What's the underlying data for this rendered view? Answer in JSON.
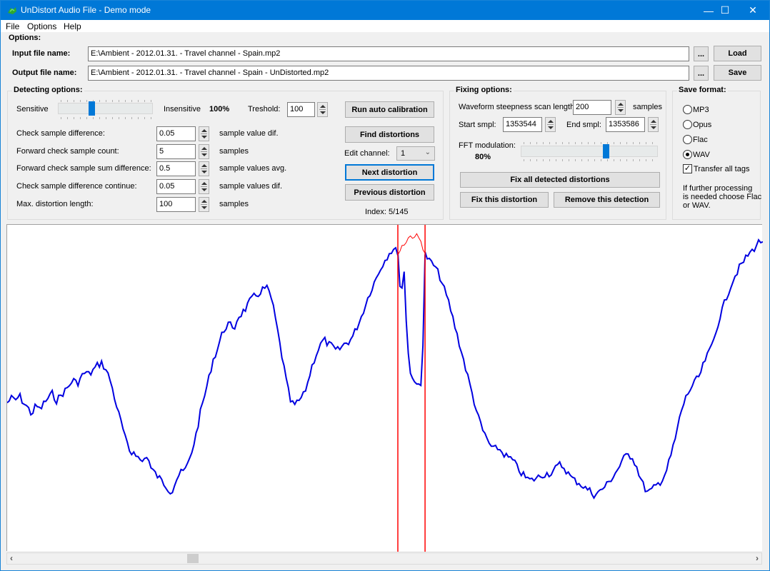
{
  "window": {
    "title": "UnDistort Audio File - Demo mode",
    "controls": {
      "minimize": "—",
      "maximize": "☐",
      "close": "✕"
    }
  },
  "menu": [
    "File",
    "Options",
    "Help"
  ],
  "options": {
    "section_label": "Options:",
    "input_label": "Input file name:",
    "input_value": "E:\\Ambient - 2012.01.31. - Travel channel - Spain.mp2",
    "output_label": "Output file name:",
    "output_value": "E:\\Ambient - 2012.01.31. - Travel channel - Spain - UnDistorted.mp2",
    "browse_label": "...",
    "load_label": "Load",
    "save_label": "Save"
  },
  "detecting": {
    "title": "Detecting options:",
    "sensitive_label": "Sensitive",
    "insensitive_label": "Insensitive",
    "sensitivity_value": "100%",
    "sensitivity_slider_fraction": 0.35,
    "threshold_label": "Treshold:",
    "threshold_value": "100",
    "params": [
      {
        "label": "Check sample difference:",
        "value": "0.05",
        "unit": "sample value dif."
      },
      {
        "label": "Forward check sample count:",
        "value": "5",
        "unit": "samples"
      },
      {
        "label": "Forward check sample sum difference:",
        "value": "0.5",
        "unit": "sample values avg."
      },
      {
        "label": "Check sample difference continue:",
        "value": "0.05",
        "unit": "sample values dif."
      },
      {
        "label": "Max. distortion length:",
        "value": "100",
        "unit": "samples"
      }
    ]
  },
  "actions": {
    "run_calibration": "Run auto calibration",
    "find_distortions": "Find distortions",
    "edit_channel_label": "Edit channel:",
    "edit_channel_value": "1",
    "next_distortion": "Next distortion",
    "previous_distortion": "Previous distortion",
    "index_text": "Index: 5/145"
  },
  "fixing": {
    "title": "Fixing options:",
    "scan_length_label": "Waveform steepness scan length:",
    "scan_length_value": "200",
    "scan_length_unit": "samples",
    "start_label": "Start smpl:",
    "start_value": "1353544",
    "end_label": "End smpl:",
    "end_value": "1353586",
    "fft_label": "FFT modulation:",
    "fft_value": "80%",
    "fft_slider_fraction": 0.62,
    "fix_all": "Fix all detected distortions",
    "fix_this": "Fix this distortion",
    "remove_detection": "Remove this detection"
  },
  "save_format": {
    "title": "Save format:",
    "options": [
      "MP3",
      "Opus",
      "Flac",
      "WAV"
    ],
    "selected": "WAV",
    "transfer_tags_label": "Transfer all tags",
    "transfer_tags_checked": true,
    "note": [
      "If further processing",
      "is needed choose Flac",
      "or WAV."
    ]
  },
  "waveform": {
    "colors": {
      "signal": "#0000e0",
      "fixed": "#ff0000",
      "marker": "#ff0000"
    },
    "marker_positions": [
      0.517,
      0.553
    ],
    "signal": [
      0.42,
      0.44,
      0.43,
      0.45,
      0.42,
      0.4,
      0.37,
      0.41,
      0.39,
      0.42,
      0.44,
      0.46,
      0.43,
      0.45,
      0.47,
      0.49,
      0.52,
      0.5,
      0.53,
      0.55,
      0.54,
      0.56,
      0.58,
      0.59,
      0.56,
      0.52,
      0.45,
      0.38,
      0.32,
      0.25,
      0.2,
      0.22,
      0.18,
      0.17,
      0.2,
      0.14,
      0.12,
      0.1,
      0.08,
      0.06,
      0.04,
      0.09,
      0.12,
      0.13,
      0.16,
      0.22,
      0.29,
      0.38,
      0.45,
      0.52,
      0.6,
      0.64,
      0.7,
      0.74,
      0.76,
      0.72,
      0.78,
      0.8,
      0.82,
      0.85,
      0.87,
      0.88,
      0.9,
      0.91,
      0.88,
      0.8,
      0.7,
      0.6,
      0.5,
      0.42,
      0.41,
      0.43,
      0.45,
      0.5,
      0.57,
      0.62,
      0.66,
      0.69,
      0.67,
      0.66,
      0.64,
      0.65,
      0.67,
      0.68,
      0.7,
      0.74,
      0.78,
      0.83,
      0.88,
      0.92,
      0.96,
      1.0,
      1.03,
      1.06,
      1.07,
      1.06
    ],
    "distorted": [
      1.06,
      0.85,
      1.0,
      0.7,
      0.55,
      0.52,
      0.5,
      0.5,
      0.49,
      1.05
    ],
    "fixed": [
      1.05,
      1.08,
      1.1,
      1.12,
      1.13,
      1.13,
      1.12,
      1.1,
      1.06
    ],
    "signal_after": [
      1.05,
      1.02,
      1.0,
      0.96,
      0.9,
      0.84,
      0.76,
      0.68,
      0.6,
      0.52,
      0.44,
      0.36,
      0.3,
      0.26,
      0.22,
      0.23,
      0.21,
      0.19,
      0.18,
      0.15,
      0.12,
      0.1,
      0.09,
      0.1,
      0.11,
      0.12,
      0.12,
      0.14,
      0.16,
      0.14,
      0.11,
      0.09,
      0.08,
      0.06,
      0.05,
      0.03,
      0.04,
      0.06,
      0.08,
      0.11,
      0.14,
      0.18,
      0.2,
      0.19,
      0.14,
      0.08,
      0.04,
      0.05,
      0.07,
      0.09,
      0.13,
      0.2,
      0.28,
      0.38,
      0.44,
      0.48,
      0.51,
      0.54,
      0.6,
      0.64,
      0.7,
      0.78,
      0.84,
      0.9,
      0.95,
      0.99,
      1.02,
      1.05,
      1.07,
      1.1,
      1.11
    ]
  }
}
